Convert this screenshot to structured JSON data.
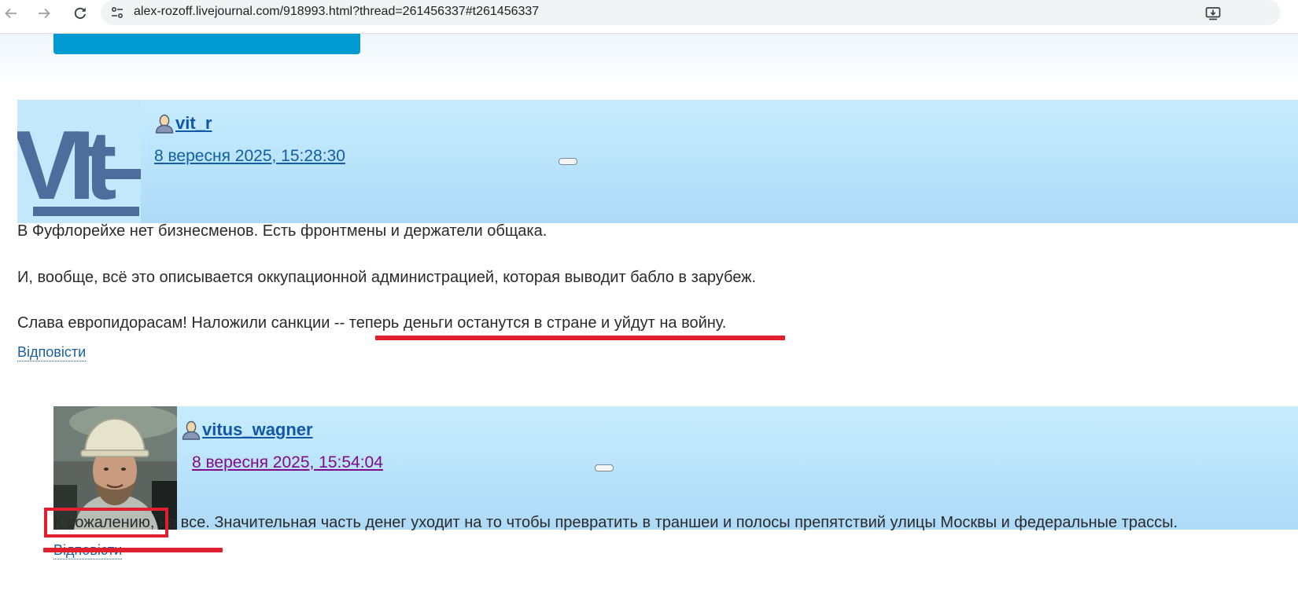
{
  "browser": {
    "url": "alex-rozoff.livejournal.com/918993.html?thread=261456337#t261456337",
    "icons": [
      "back-icon",
      "forward-icon",
      "reload-icon",
      "site-info-icon",
      "install-app-icon"
    ]
  },
  "comments": [
    {
      "username": "vit_r",
      "timestamp": "8 вересня 2025, 15:28:30",
      "paragraphs": [
        "В Фуфлорейхе нет бизнесменов. Есть фронтмены и держатели общака.",
        "И, вообще, всё это описывается оккупационной администрацией, которая выводит бабло в зарубеж.",
        "Слава европидорасам! Наложили санкции -- теперь деньги останутся в стране и уйдут на войну."
      ],
      "reply_label": "Відповісти",
      "avatar_text": "VIt"
    },
    {
      "username": "vitus_wagner",
      "timestamp": "8 вересня 2025, 15:54:04",
      "paragraphs": [
        "К сожалению, не все. Значительная часть денег уходит на то чтобы превратить в траншеи и полосы препятствий улицы Москвы и федеральные трассы."
      ],
      "reply_label": "Відповісти"
    }
  ],
  "annotation_color": "#e0202e"
}
